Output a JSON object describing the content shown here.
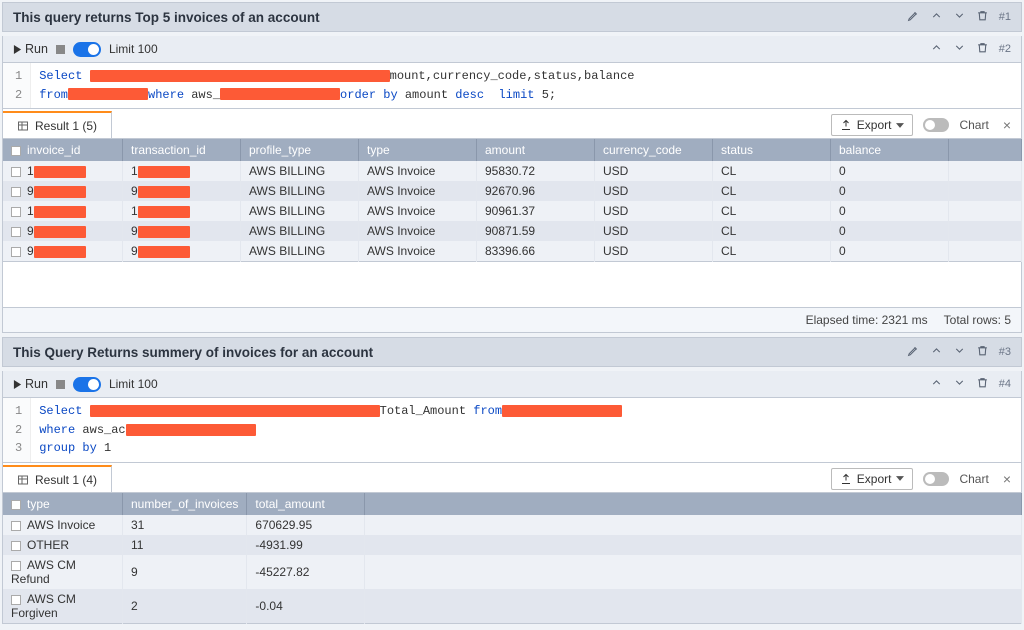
{
  "cells": [
    {
      "num": "#1",
      "title": "This query returns Top 5 invoices of an account"
    },
    {
      "num": "#2",
      "run_label": "Run",
      "limit_label": "Limit 100"
    }
  ],
  "sql1": {
    "ln1": "1",
    "ln2": "2",
    "select": "Select",
    "tail1": "mount,currency_code,status,balance",
    "from": "from",
    "where": "where",
    "aws": " aws_",
    "orderby": "order by",
    "amount": " amount ",
    "desc": "desc",
    "limit": "  limit",
    "limitn": " 5;"
  },
  "result1": {
    "tab_label": "Result 1 (5)",
    "export_label": "Export",
    "chart_label": "Chart",
    "cols": {
      "c0": "invoice_id",
      "c1": "transaction_id",
      "c2": "profile_type",
      "c3": "type",
      "c4": "amount",
      "c5": "currency_code",
      "c6": "status",
      "c7": "balance"
    },
    "rows": [
      {
        "pfx0": "1",
        "pfx1": "1",
        "c2": "AWS BILLING",
        "c3": "AWS Invoice",
        "c4": "95830.72",
        "c5": "USD",
        "c6": "CL",
        "c7": "0"
      },
      {
        "pfx0": "9",
        "pfx1": "9",
        "c2": "AWS BILLING",
        "c3": "AWS Invoice",
        "c4": "92670.96",
        "c5": "USD",
        "c6": "CL",
        "c7": "0"
      },
      {
        "pfx0": "1",
        "pfx1": "1",
        "c2": "AWS BILLING",
        "c3": "AWS Invoice",
        "c4": "90961.37",
        "c5": "USD",
        "c6": "CL",
        "c7": "0"
      },
      {
        "pfx0": "9",
        "pfx1": "9",
        "c2": "AWS BILLING",
        "c3": "AWS Invoice",
        "c4": "90871.59",
        "c5": "USD",
        "c6": "CL",
        "c7": "0"
      },
      {
        "pfx0": "9",
        "pfx1": "9",
        "c2": "AWS BILLING",
        "c3": "AWS Invoice",
        "c4": "83396.66",
        "c5": "USD",
        "c6": "CL",
        "c7": "0"
      }
    ],
    "footer": {
      "elapsed": "Elapsed time: 2321 ms",
      "total": "Total rows: 5"
    }
  },
  "cells2": [
    {
      "num": "#3",
      "title": "This Query Returns summery of invoices for an account"
    },
    {
      "num": "#4",
      "run_label": "Run",
      "limit_label": "Limit 100"
    }
  ],
  "sql2": {
    "ln1": "1",
    "ln2": "2",
    "ln3": "3",
    "select": "Select",
    "total": "Total_Amount ",
    "from": "from",
    "where": "where",
    "aws": " aws_ac",
    "group": "group by",
    "one": " 1"
  },
  "result2": {
    "tab_label": "Result 1 (4)",
    "export_label": "Export",
    "chart_label": "Chart",
    "cols": {
      "c0": "type",
      "c1": "number_of_invoices",
      "c2": "total_amount"
    },
    "rows": [
      {
        "c0": "AWS Invoice",
        "c1": "31",
        "c2": "670629.95"
      },
      {
        "c0": "OTHER",
        "c1": "11",
        "c2": "-4931.99"
      },
      {
        "c0": "AWS CM Refund",
        "c1": "9",
        "c2": "-45227.82"
      },
      {
        "c0": "AWS CM Forgiven",
        "c1": "2",
        "c2": "-0.04"
      }
    ]
  }
}
